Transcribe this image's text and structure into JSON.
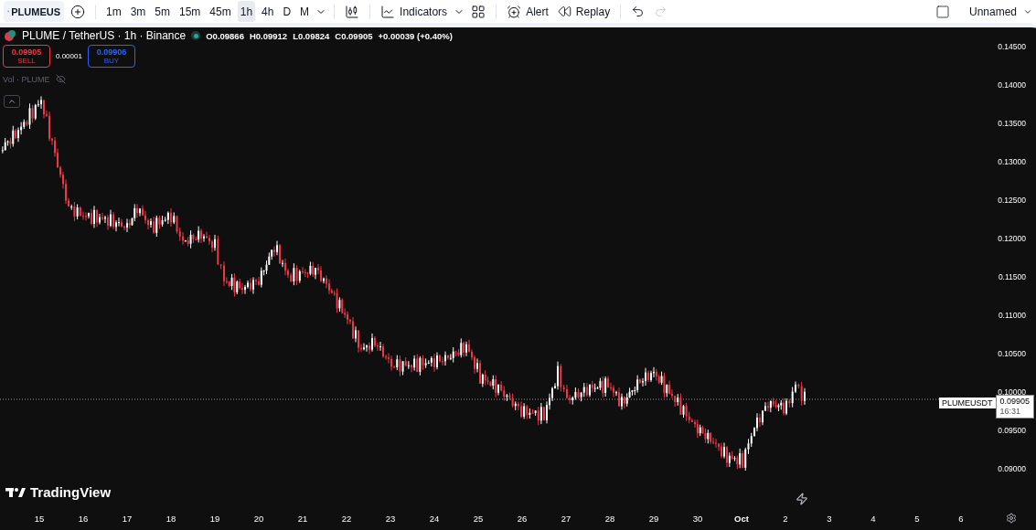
{
  "toolbar": {
    "search": {
      "value": "PLUMEUS"
    },
    "intervals": [
      {
        "label": "1m",
        "selected": false
      },
      {
        "label": "3m",
        "selected": false
      },
      {
        "label": "5m",
        "selected": false
      },
      {
        "label": "15m",
        "selected": false
      },
      {
        "label": "45m",
        "selected": false
      },
      {
        "label": "1h",
        "selected": true
      },
      {
        "label": "4h",
        "selected": false
      },
      {
        "label": "D",
        "selected": false
      },
      {
        "label": "M",
        "selected": false
      }
    ],
    "indicators": "Indicators",
    "alert": "Alert",
    "replay": "Replay",
    "redo_disabled": true,
    "layout_name": "Unnamed"
  },
  "legend": {
    "title": "PLUME / TetherUS · 1h · Binance",
    "open": "O0.09866",
    "high": "H0.09912",
    "low": "L0.09824",
    "close": "C0.09905",
    "change": "+0.00039 (+0.40%)",
    "sell": {
      "price": "0.09905",
      "label": "SELL"
    },
    "spread": "0.00001",
    "buy": {
      "price": "0.09906",
      "label": "BUY"
    },
    "volume": "Vol · PLUME"
  },
  "chart": {
    "kind": "picture",
    "price_axis": [
      "0.14500",
      "0.14000",
      "0.13500",
      "0.13000",
      "0.12500",
      "0.12000",
      "0.11500",
      "0.11000",
      "0.10500",
      "0.10000",
      "0.09500",
      "0.09000"
    ],
    "date_axis": [
      "15",
      "16",
      "17",
      "18",
      "19",
      "20",
      "21",
      "22",
      "23",
      "24",
      "25",
      "26",
      "27",
      "28",
      "29",
      "30",
      "Oct",
      "2",
      "3",
      "4",
      "5",
      "6"
    ],
    "last_price": {
      "symbol": "PLUMEUSDT",
      "price": "0.09905",
      "countdown": "16:31"
    },
    "brand": "TradingView"
  }
}
